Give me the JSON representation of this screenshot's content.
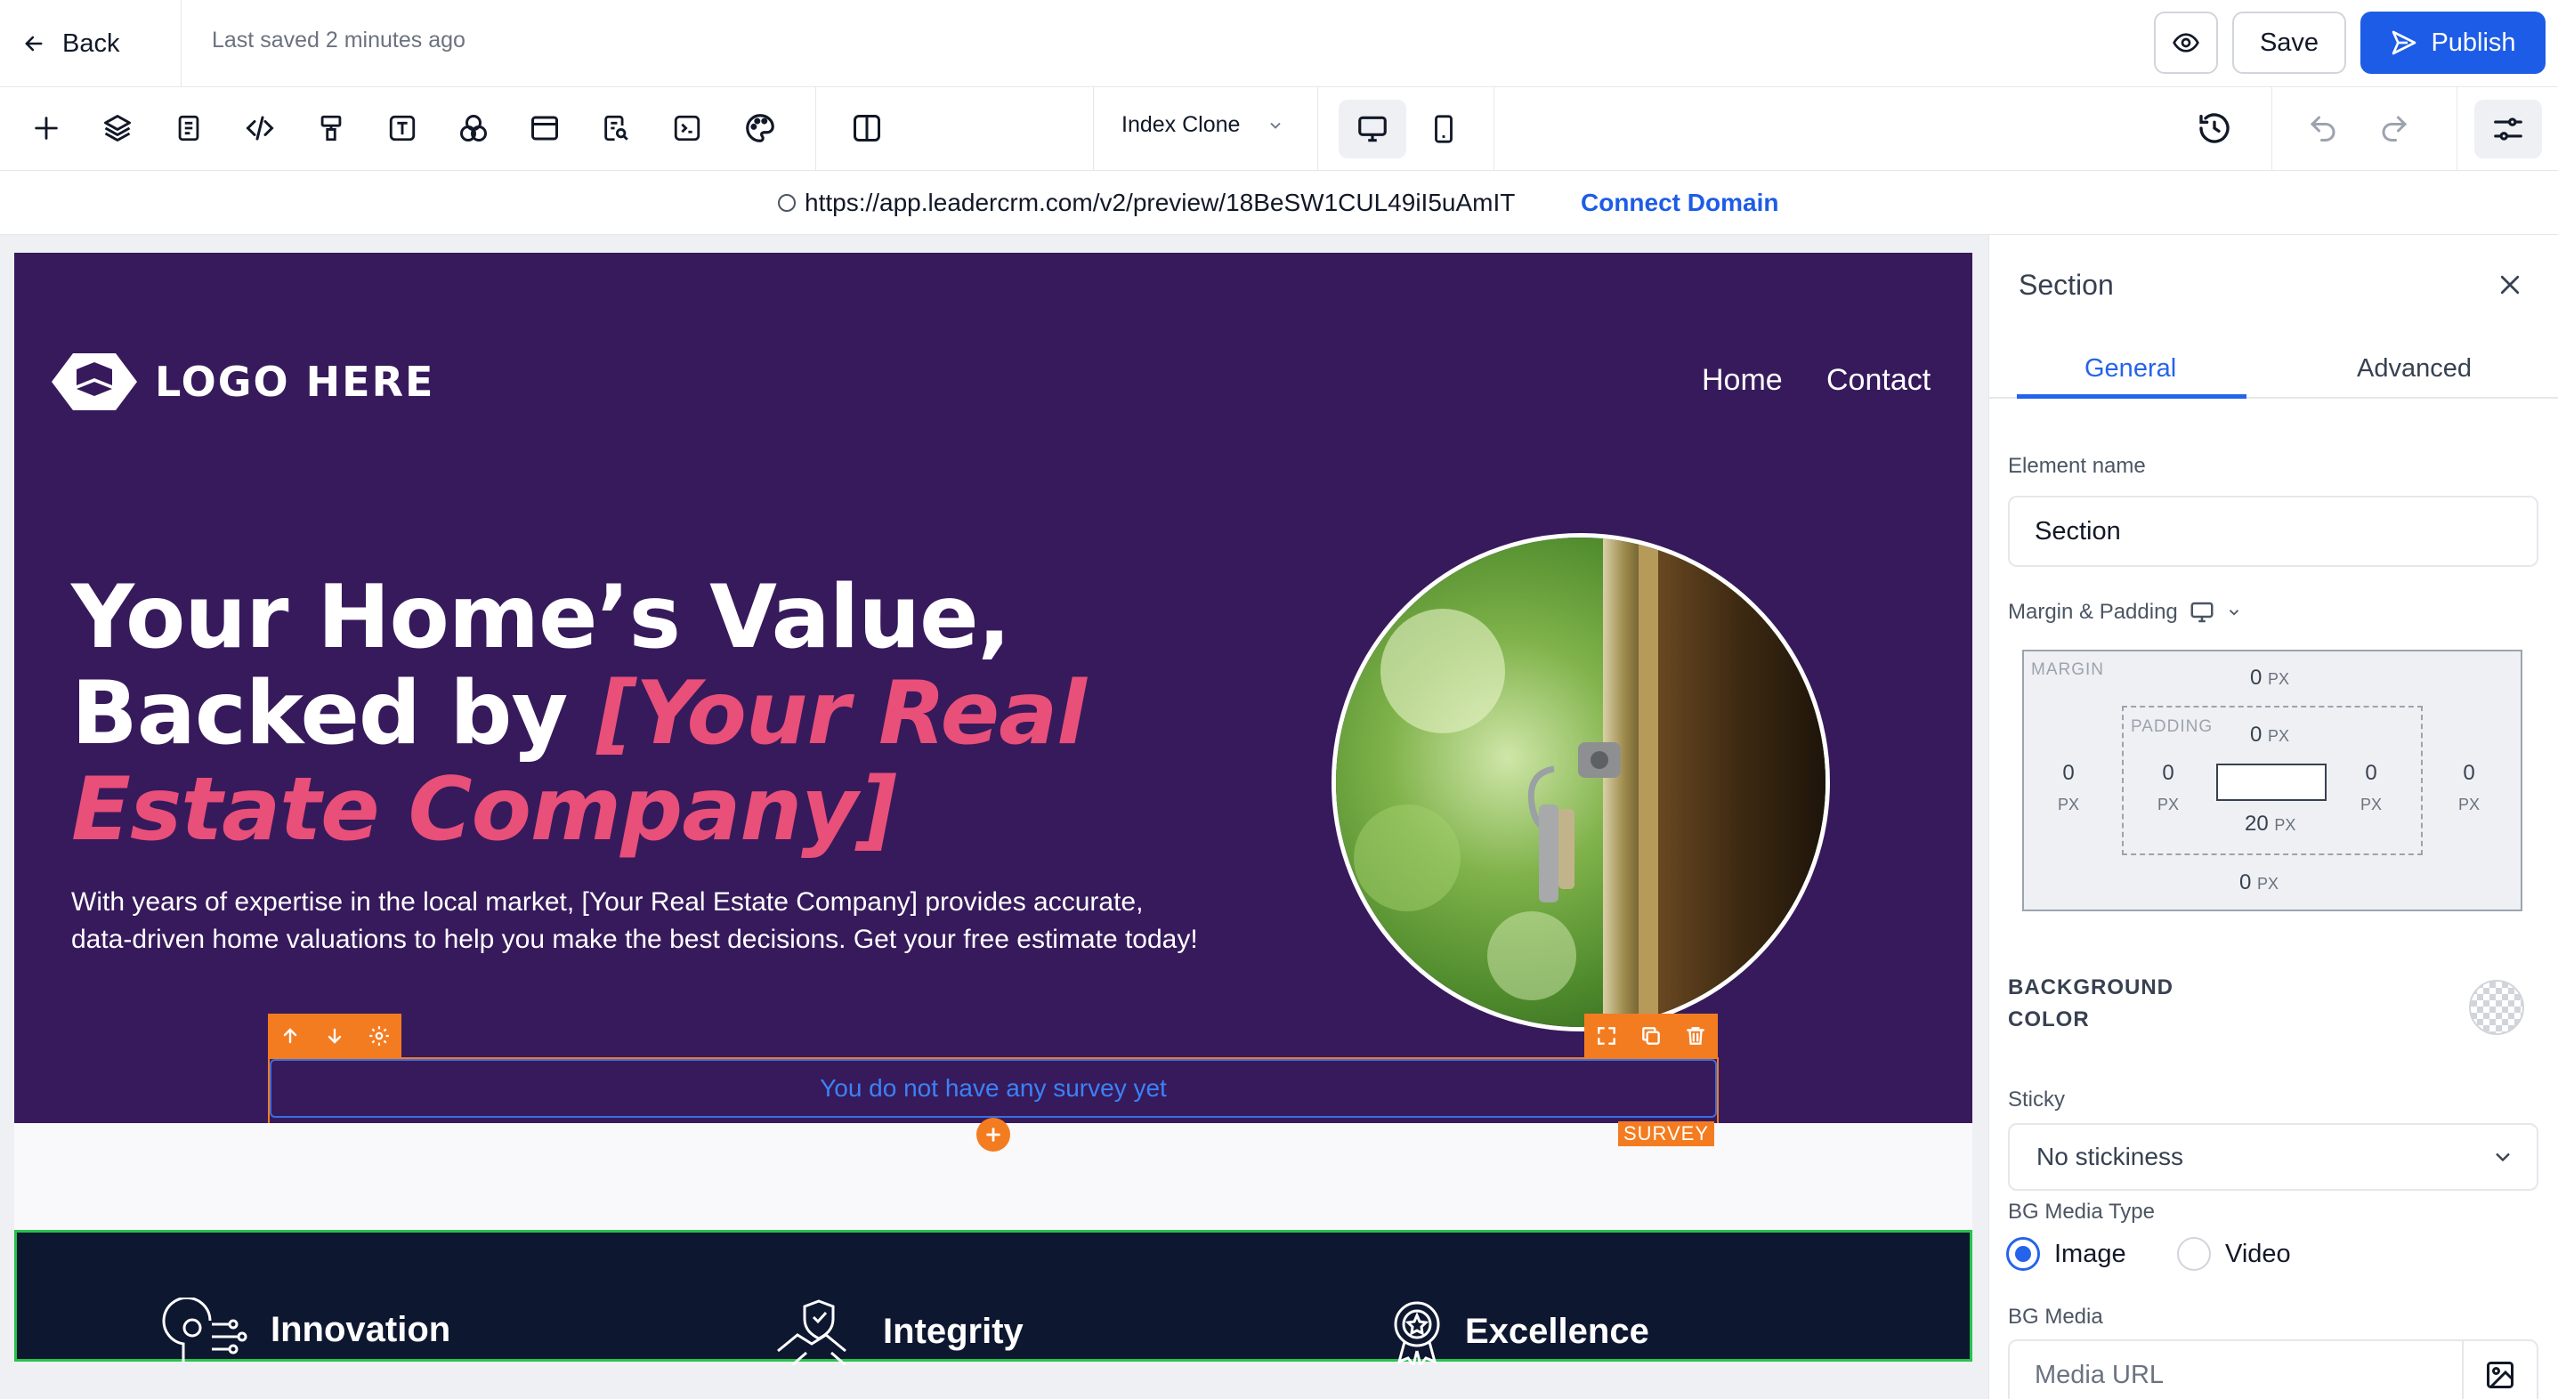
{
  "topbar": {
    "back_label": "Back",
    "saved_text": "Last saved 2 minutes ago",
    "save_label": "Save",
    "publish_label": "Publish"
  },
  "toolbar": {
    "page_name": "Index Clone",
    "icons": [
      "plus-icon",
      "layers-icon",
      "page-icon",
      "code-icon",
      "paint-icon",
      "text-icon",
      "shapes-icon",
      "window-icon",
      "search-doc-icon",
      "terminal-icon",
      "palette-icon",
      "columns-icon"
    ]
  },
  "urlbar": {
    "url": "https://app.leadercrm.com/v2/preview/18BeSW1CUL49iI5uAmIT",
    "connect_label": "Connect Domain"
  },
  "site": {
    "logo_text": "LOGO HERE",
    "nav": [
      "Home",
      "Contact"
    ],
    "hero_line1": "Your Home’s Value,",
    "hero_line2": "Backed by ",
    "hero_accent1": "[Your Real",
    "hero_accent2": "Estate Company]",
    "hero_text": "With years of expertise in the local market, [Your Real Estate Company] provides accurate, data-driven home valuations to help you make the best decisions. Get your free estimate today!",
    "survey_empty": "You do not have any survey yet",
    "survey_tag": "SURVEY",
    "values": [
      "Innovation",
      "Integrity",
      "Excellence"
    ]
  },
  "panel": {
    "title": "Section",
    "tabs": [
      "General",
      "Advanced"
    ],
    "element_name_label": "Element name",
    "element_name_value": "Section",
    "margin_padding_label": "Margin & Padding",
    "margin_label": "MARGIN",
    "padding_label": "PADDING",
    "unit": "PX",
    "margin": {
      "top": "0",
      "right": "0",
      "bottom": "0",
      "left": "0"
    },
    "padding": {
      "top": "0",
      "right": "0",
      "bottom": "20",
      "left": "0"
    },
    "bg_color_label_1": "BACKGROUND",
    "bg_color_label_2": "COLOR",
    "sticky_label": "Sticky",
    "sticky_value": "No stickiness",
    "bg_media_type_label": "BG Media Type",
    "media_types": [
      "Image",
      "Video"
    ],
    "bg_media_label": "BG Media",
    "media_placeholder": "Media URL"
  },
  "colors": {
    "accent": "#1d5ce6",
    "hero_bg": "#371a5c",
    "hero_accent": "#e84f79",
    "selection": "#f47c20",
    "dark_section": "#0e1730"
  }
}
